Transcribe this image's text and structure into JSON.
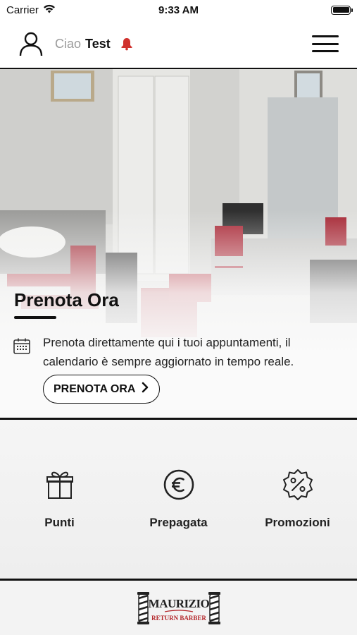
{
  "status_bar": {
    "carrier": "Carrier",
    "time": "9:33 AM",
    "icons": [
      "wifi-icon",
      "battery-icon"
    ]
  },
  "header": {
    "greeting_word": "Ciao",
    "user_name": "Test",
    "icons": [
      "user-icon",
      "bell-icon",
      "hamburger-menu-icon"
    ],
    "bell_color": "#d0312d"
  },
  "hero": {
    "title": "Prenota Ora",
    "description": "Prenota direttamente qui i tuoi appuntamenti, il calendario è sempre aggiornato in tempo reale.",
    "button_label": "PRENOTA ORA",
    "icons": [
      "calendar-icon",
      "chevron-right-icon"
    ]
  },
  "features": {
    "items": [
      {
        "label": "Punti",
        "icon": "gift-icon"
      },
      {
        "label": "Prepagata",
        "icon": "euro-icon"
      },
      {
        "label": "Promozioni",
        "icon": "discount-badge-icon"
      }
    ]
  },
  "footer": {
    "logo_top": "MAURIZIO",
    "logo_bottom": "RETURN BARBER",
    "brand_color": "#b3262a"
  }
}
